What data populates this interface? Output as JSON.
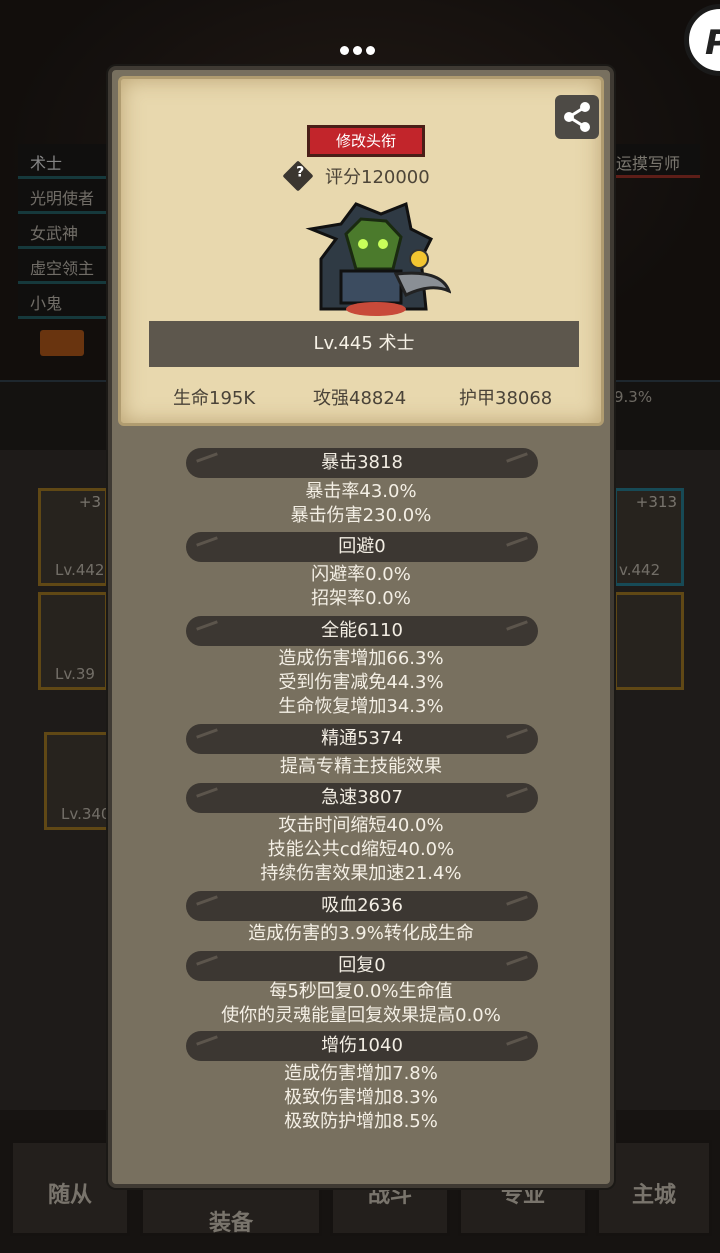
{
  "background": {
    "class_list": [
      "术士",
      "光明使者",
      "女武神",
      "虚空领主",
      "小鬼"
    ],
    "right_tag": "运摸写师",
    "percent_fragment": "9.3%",
    "slots": [
      {
        "plus": "+3",
        "level": "Lv.442"
      },
      {
        "plus": "",
        "level": "Lv.39"
      },
      {
        "plus": "",
        "level": "Lv.340"
      },
      {
        "plus": "+313",
        "level": "v.442"
      }
    ],
    "bottom_nav": [
      "随从",
      "装备",
      "战斗",
      "专业",
      "主城"
    ]
  },
  "panel": {
    "title_button": "修改头衔",
    "score_label": "评分120000",
    "hero_level": "Lv.445 术士",
    "hp": "生命195K",
    "attack": "攻强48824",
    "armor": "护甲38068"
  },
  "sections": [
    {
      "head": "暴击3818",
      "lines": [
        "暴击率43.0%",
        "暴击伤害230.0%"
      ]
    },
    {
      "head": "回避0",
      "lines": [
        "闪避率0.0%",
        "招架率0.0%"
      ]
    },
    {
      "head": "全能6110",
      "lines": [
        "造成伤害增加66.3%",
        "受到伤害减免44.3%",
        "生命恢复增加34.3%"
      ]
    },
    {
      "head": "精通5374",
      "lines": [
        "提高专精主技能效果"
      ]
    },
    {
      "head": "急速3807",
      "lines": [
        "攻击时间缩短40.0%",
        "技能公共cd缩短40.0%",
        "持续伤害效果加速21.4%"
      ]
    },
    {
      "head": "吸血2636",
      "lines": [
        "造成伤害的3.9%转化成生命"
      ]
    },
    {
      "head": "回复0",
      "lines": [
        "每5秒回复0.0%生命值",
        "使你的灵魂能量回复效果提高0.0%"
      ]
    },
    {
      "head": "增伤1040",
      "lines": [
        "造成伤害增加7.8%",
        "极致伤害增加8.3%",
        "极致防护增加8.5%"
      ]
    }
  ]
}
